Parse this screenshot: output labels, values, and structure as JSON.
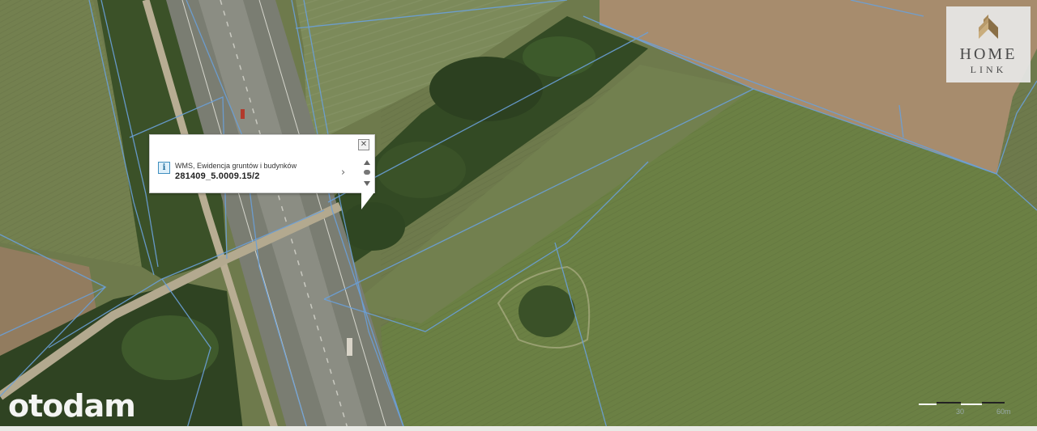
{
  "popup": {
    "layer_name": "WMS, Ewidencja gruntów i budynków",
    "parcel_id": "281409_5.0009.15/2",
    "icons": {
      "info": "info-icon",
      "close": "close-icon",
      "next": "chevron-right-icon",
      "up": "arrow-up-icon",
      "center": "dot-icon",
      "down": "arrow-down-icon"
    }
  },
  "logo": {
    "top": "HOME",
    "bottom": "LINK"
  },
  "watermark": {
    "text": "otodam"
  },
  "scale": {
    "label_mid": "30",
    "label_end": "60m"
  },
  "colors": {
    "parcel_lines": "#6aa0d8",
    "field": "#6b8044",
    "plowed_field": "#a78c6d",
    "forest": "#334a24"
  }
}
